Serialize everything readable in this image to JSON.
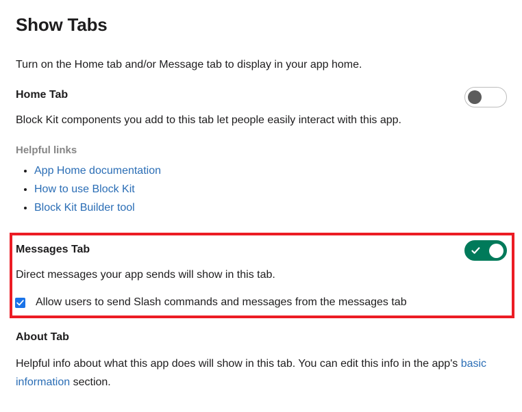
{
  "page": {
    "title": "Show Tabs",
    "intro": "Turn on the Home tab and/or Message tab to display in your app home."
  },
  "home_tab": {
    "heading": "Home Tab",
    "description": "Block Kit components you add to this tab let people easily interact with this app.",
    "toggle": {
      "state": "off",
      "icon": "toggle-off-icon",
      "knob_color": "#5c5c5c",
      "track_color": "#ffffff",
      "border_color": "#bdbdbd"
    },
    "helpful_links_label": "Helpful links",
    "links": [
      {
        "label": "App Home documentation"
      },
      {
        "label": "How to use Block Kit"
      },
      {
        "label": "Block Kit Builder tool"
      }
    ]
  },
  "messages_tab": {
    "heading": "Messages Tab",
    "description": "Direct messages your app sends will show in this tab.",
    "toggle": {
      "state": "on",
      "icon": "toggle-on-icon",
      "track_color": "#007a5a",
      "knob_color": "#ffffff"
    },
    "checkbox": {
      "checked": true,
      "label": "Allow users to send Slash commands and messages from the messages tab",
      "color": "#1a73e8"
    },
    "highlight": {
      "color": "#ec1c24"
    }
  },
  "about_tab": {
    "heading": "About Tab",
    "description_part1": "Helpful info about what this app does will show in this tab. You can edit this info in the app's ",
    "link_label": "basic information",
    "description_part2": " section."
  },
  "colors": {
    "link": "#2a6db5",
    "text": "#1d1c1d",
    "muted": "#868686",
    "green": "#007a5a",
    "red": "#ec1c24",
    "blue_checkbox": "#1a73e8"
  }
}
